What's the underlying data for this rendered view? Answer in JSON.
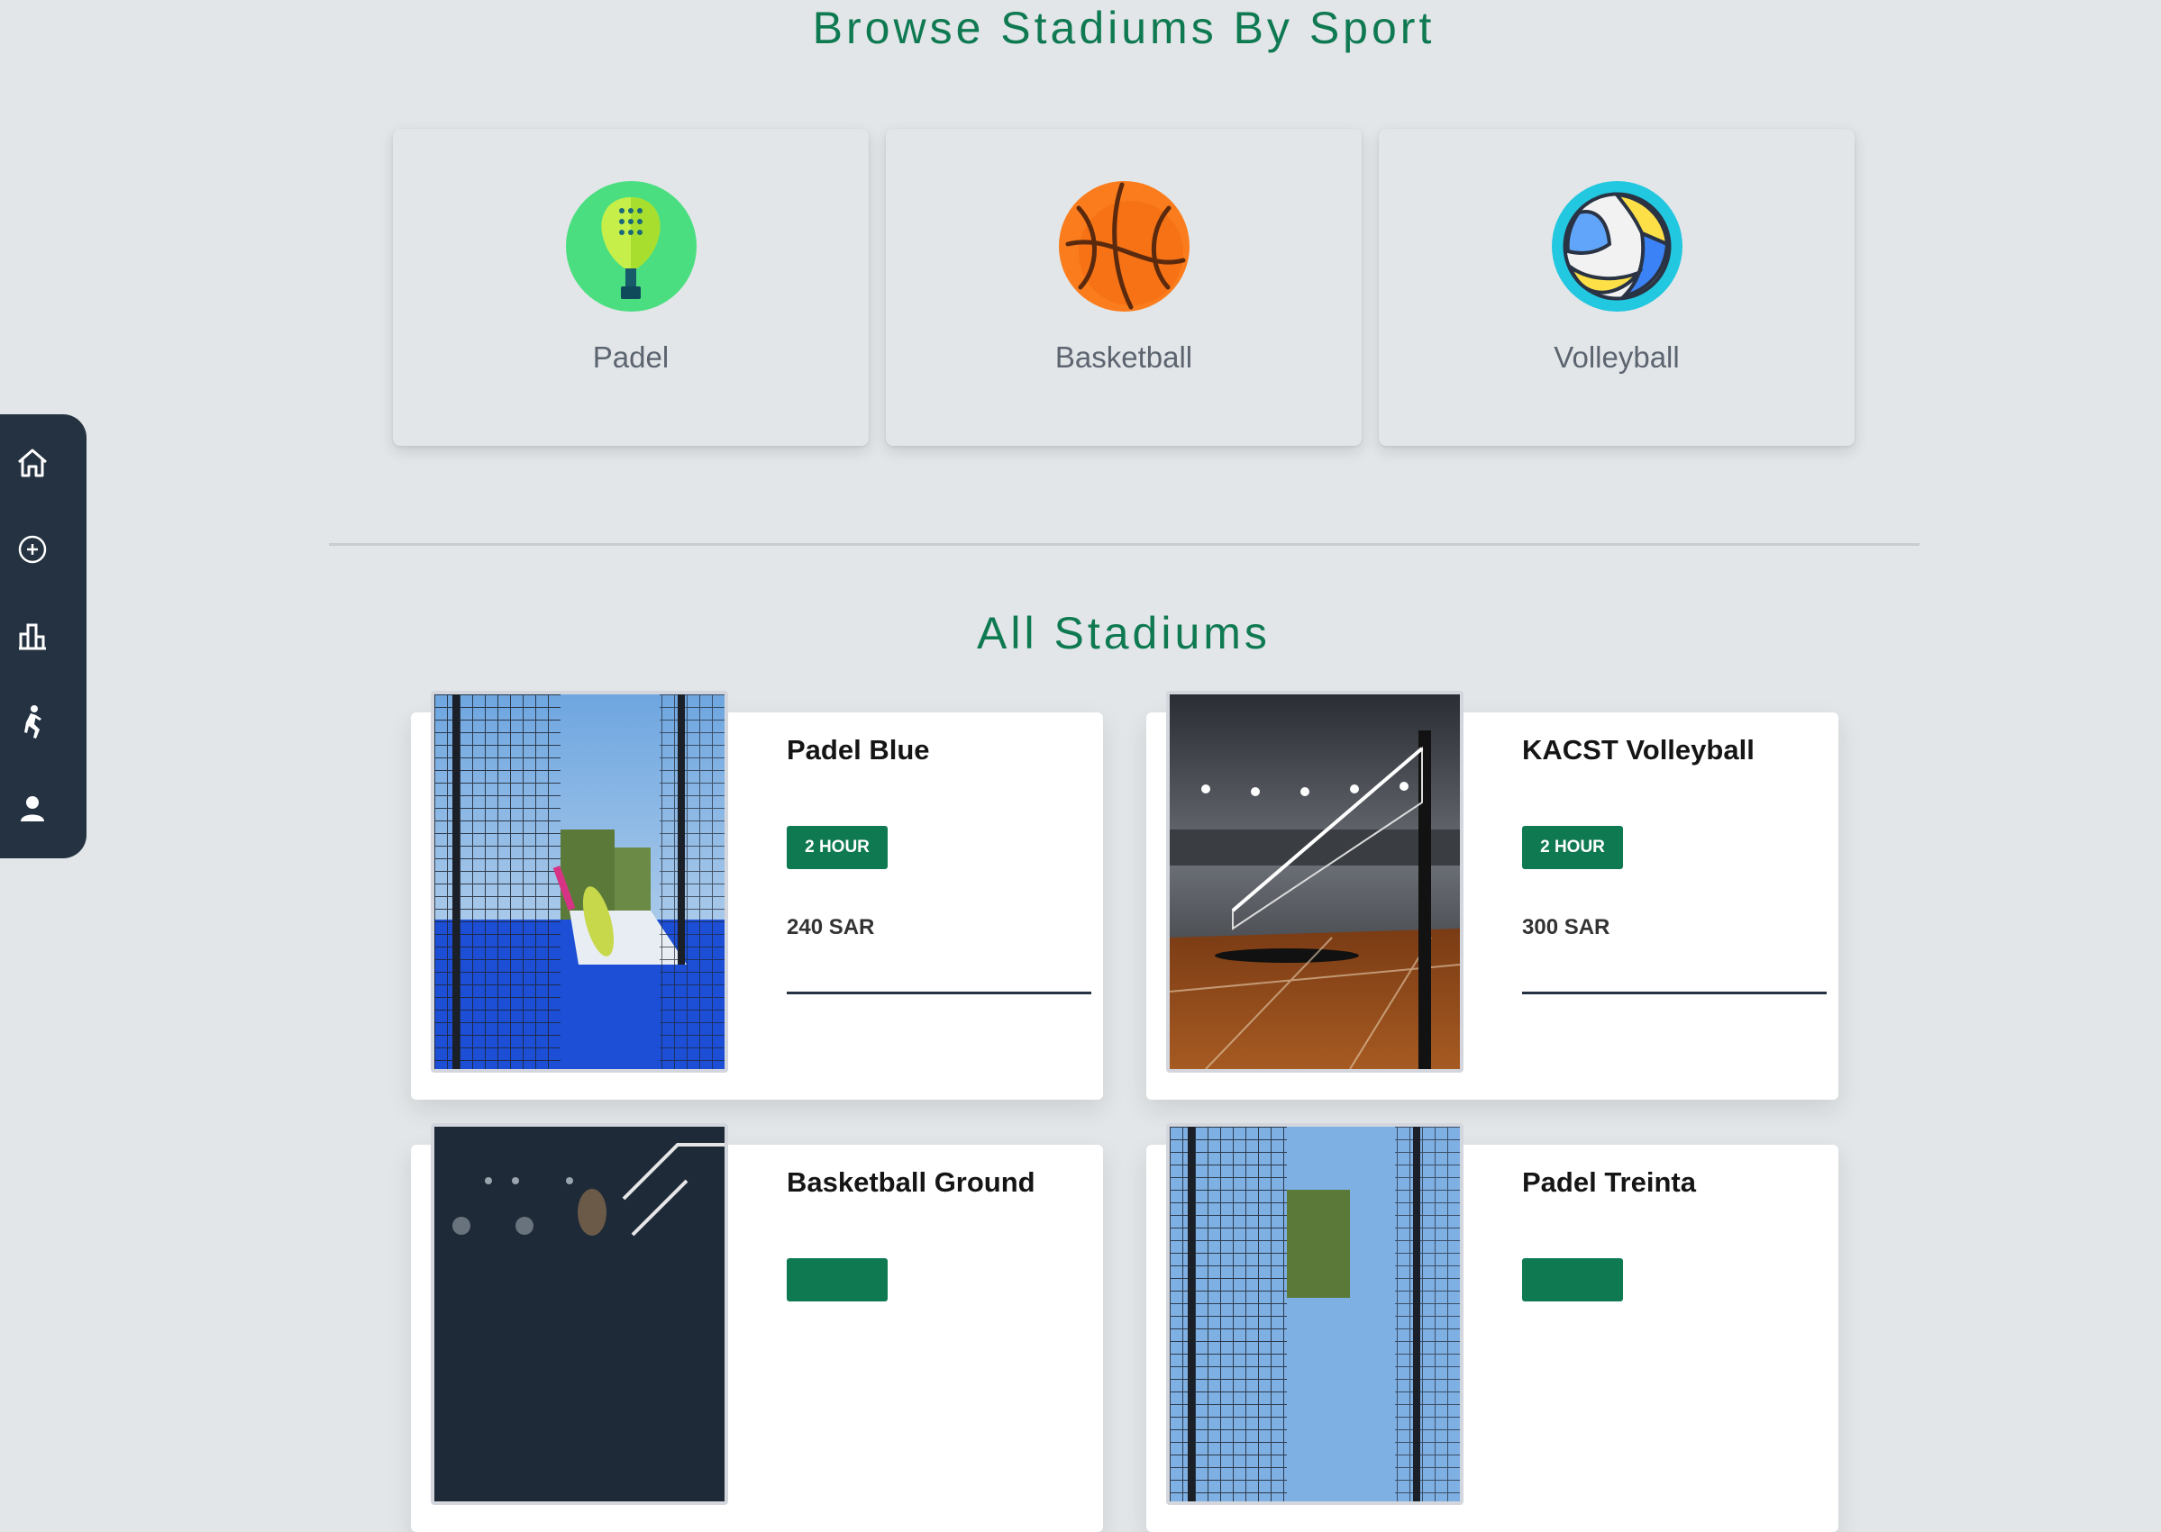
{
  "browse": {
    "title": "Browse Stadiums By Sport",
    "sports": [
      {
        "label": "Padel",
        "icon": "padel-racket-icon"
      },
      {
        "label": "Basketball",
        "icon": "basketball-icon"
      },
      {
        "label": "Volleyball",
        "icon": "volleyball-icon"
      }
    ]
  },
  "all_stadiums": {
    "title": "All Stadiums",
    "stadiums": [
      {
        "name": "Padel Blue",
        "duration": "2 HOUR",
        "price": "240 SAR"
      },
      {
        "name": "KACST Volleyball",
        "duration": "2 HOUR",
        "price": "300 SAR"
      },
      {
        "name": "Basketball Ground",
        "duration": "",
        "price": ""
      },
      {
        "name": "Padel Treinta",
        "duration": "",
        "price": ""
      }
    ]
  },
  "sidebar": {
    "items": [
      {
        "icon": "home-icon"
      },
      {
        "icon": "add-circle-icon"
      },
      {
        "icon": "chart-icon"
      },
      {
        "icon": "player-icon"
      },
      {
        "icon": "user-icon"
      }
    ]
  },
  "colors": {
    "accent": "#0f7a52",
    "sidebar": "#243241",
    "background": "#e2e6e8"
  }
}
